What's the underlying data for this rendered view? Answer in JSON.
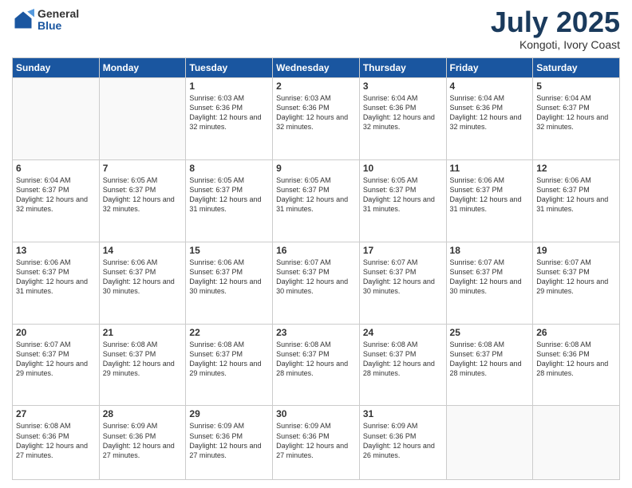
{
  "logo": {
    "general": "General",
    "blue": "Blue"
  },
  "header": {
    "month": "July 2025",
    "location": "Kongoti, Ivory Coast"
  },
  "weekdays": [
    "Sunday",
    "Monday",
    "Tuesday",
    "Wednesday",
    "Thursday",
    "Friday",
    "Saturday"
  ],
  "weeks": [
    [
      {
        "day": "",
        "info": ""
      },
      {
        "day": "",
        "info": ""
      },
      {
        "day": "1",
        "info": "Sunrise: 6:03 AM\nSunset: 6:36 PM\nDaylight: 12 hours and 32 minutes."
      },
      {
        "day": "2",
        "info": "Sunrise: 6:03 AM\nSunset: 6:36 PM\nDaylight: 12 hours and 32 minutes."
      },
      {
        "day": "3",
        "info": "Sunrise: 6:04 AM\nSunset: 6:36 PM\nDaylight: 12 hours and 32 minutes."
      },
      {
        "day": "4",
        "info": "Sunrise: 6:04 AM\nSunset: 6:36 PM\nDaylight: 12 hours and 32 minutes."
      },
      {
        "day": "5",
        "info": "Sunrise: 6:04 AM\nSunset: 6:37 PM\nDaylight: 12 hours and 32 minutes."
      }
    ],
    [
      {
        "day": "6",
        "info": "Sunrise: 6:04 AM\nSunset: 6:37 PM\nDaylight: 12 hours and 32 minutes."
      },
      {
        "day": "7",
        "info": "Sunrise: 6:05 AM\nSunset: 6:37 PM\nDaylight: 12 hours and 32 minutes."
      },
      {
        "day": "8",
        "info": "Sunrise: 6:05 AM\nSunset: 6:37 PM\nDaylight: 12 hours and 31 minutes."
      },
      {
        "day": "9",
        "info": "Sunrise: 6:05 AM\nSunset: 6:37 PM\nDaylight: 12 hours and 31 minutes."
      },
      {
        "day": "10",
        "info": "Sunrise: 6:05 AM\nSunset: 6:37 PM\nDaylight: 12 hours and 31 minutes."
      },
      {
        "day": "11",
        "info": "Sunrise: 6:06 AM\nSunset: 6:37 PM\nDaylight: 12 hours and 31 minutes."
      },
      {
        "day": "12",
        "info": "Sunrise: 6:06 AM\nSunset: 6:37 PM\nDaylight: 12 hours and 31 minutes."
      }
    ],
    [
      {
        "day": "13",
        "info": "Sunrise: 6:06 AM\nSunset: 6:37 PM\nDaylight: 12 hours and 31 minutes."
      },
      {
        "day": "14",
        "info": "Sunrise: 6:06 AM\nSunset: 6:37 PM\nDaylight: 12 hours and 30 minutes."
      },
      {
        "day": "15",
        "info": "Sunrise: 6:06 AM\nSunset: 6:37 PM\nDaylight: 12 hours and 30 minutes."
      },
      {
        "day": "16",
        "info": "Sunrise: 6:07 AM\nSunset: 6:37 PM\nDaylight: 12 hours and 30 minutes."
      },
      {
        "day": "17",
        "info": "Sunrise: 6:07 AM\nSunset: 6:37 PM\nDaylight: 12 hours and 30 minutes."
      },
      {
        "day": "18",
        "info": "Sunrise: 6:07 AM\nSunset: 6:37 PM\nDaylight: 12 hours and 30 minutes."
      },
      {
        "day": "19",
        "info": "Sunrise: 6:07 AM\nSunset: 6:37 PM\nDaylight: 12 hours and 29 minutes."
      }
    ],
    [
      {
        "day": "20",
        "info": "Sunrise: 6:07 AM\nSunset: 6:37 PM\nDaylight: 12 hours and 29 minutes."
      },
      {
        "day": "21",
        "info": "Sunrise: 6:08 AM\nSunset: 6:37 PM\nDaylight: 12 hours and 29 minutes."
      },
      {
        "day": "22",
        "info": "Sunrise: 6:08 AM\nSunset: 6:37 PM\nDaylight: 12 hours and 29 minutes."
      },
      {
        "day": "23",
        "info": "Sunrise: 6:08 AM\nSunset: 6:37 PM\nDaylight: 12 hours and 28 minutes."
      },
      {
        "day": "24",
        "info": "Sunrise: 6:08 AM\nSunset: 6:37 PM\nDaylight: 12 hours and 28 minutes."
      },
      {
        "day": "25",
        "info": "Sunrise: 6:08 AM\nSunset: 6:37 PM\nDaylight: 12 hours and 28 minutes."
      },
      {
        "day": "26",
        "info": "Sunrise: 6:08 AM\nSunset: 6:36 PM\nDaylight: 12 hours and 28 minutes."
      }
    ],
    [
      {
        "day": "27",
        "info": "Sunrise: 6:08 AM\nSunset: 6:36 PM\nDaylight: 12 hours and 27 minutes."
      },
      {
        "day": "28",
        "info": "Sunrise: 6:09 AM\nSunset: 6:36 PM\nDaylight: 12 hours and 27 minutes."
      },
      {
        "day": "29",
        "info": "Sunrise: 6:09 AM\nSunset: 6:36 PM\nDaylight: 12 hours and 27 minutes."
      },
      {
        "day": "30",
        "info": "Sunrise: 6:09 AM\nSunset: 6:36 PM\nDaylight: 12 hours and 27 minutes."
      },
      {
        "day": "31",
        "info": "Sunrise: 6:09 AM\nSunset: 6:36 PM\nDaylight: 12 hours and 26 minutes."
      },
      {
        "day": "",
        "info": ""
      },
      {
        "day": "",
        "info": ""
      }
    ]
  ]
}
